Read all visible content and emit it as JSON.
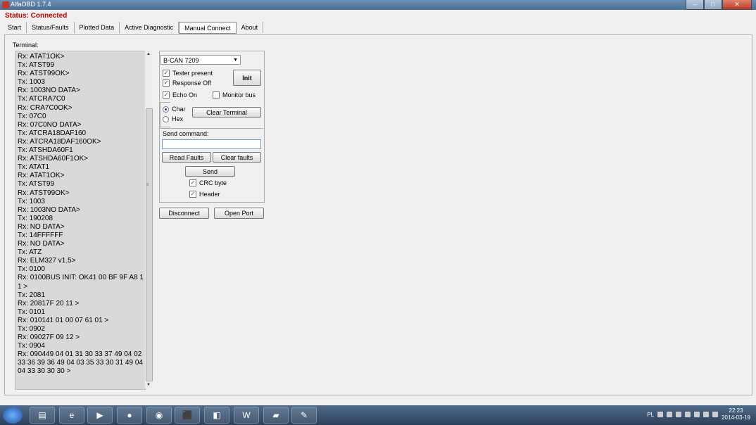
{
  "window": {
    "title": "AlfaOBD 1.7.4"
  },
  "status": "Status: Connected",
  "tabs": [
    "Start",
    "Status/Faults",
    "Plotted Data",
    "Active Diagnostic",
    "Manual Connect",
    "About"
  ],
  "active_tab": "Manual Connect",
  "terminal": {
    "label": "Terminal:",
    "lines": [
      "Rx: ATAT1OK>",
      "Tx: ATST99",
      "Rx: ATST99OK>",
      "Tx: 1003",
      "Rx: 1003NO DATA>",
      "Tx: ATCRA7C0",
      "Rx: CRA7C0OK>",
      "Tx: 07C0",
      "Rx: 07C0NO DATA>",
      "Tx: ATCRA18DAF160",
      "Rx: ATCRA18DAF160OK>",
      "Tx: ATSHDA60F1",
      "Rx: ATSHDA60F1OK>",
      "Tx: ATAT1",
      "Rx: ATAT1OK>",
      "Tx: ATST99",
      "Rx: ATST99OK>",
      "Tx: 1003",
      "Rx: 1003NO DATA>",
      "Tx: 190208",
      "Rx: NO DATA>",
      "Tx: 14FFFFFF",
      "Rx: NO DATA>",
      "Tx: ATZ",
      "Rx: ELM327 v1.5>",
      "Tx: 0100",
      "Rx: 0100BUS INIT: OK41 00 BF 9F A8 11 >",
      "Tx: 2081",
      "Rx: 20817F 20 11 >",
      "Tx: 0101",
      "Rx: 010141 01 00 07 61 01 >",
      "Tx: 0902",
      "Rx: 09027F 09 12 >",
      "Tx: 0904",
      "Rx: 090449 04 01 31 30 33 37 49 04 02 33 36 39 36 49 04 03 35 33 30 31 49 04 04 33 30 30 30 >"
    ]
  },
  "controls": {
    "bus_select": "B-CAN 7209",
    "tester_present": "Tester present",
    "response_off": "Response Off",
    "init": "Init",
    "echo_on": "Echo On",
    "monitor_bus": "Monitor bus",
    "char": "Char",
    "hex": "Hex",
    "clear_terminal": "Clear Terminal",
    "send_command_label": "Send command:",
    "send_command_value": "",
    "read_faults": "Read Faults",
    "clear_faults": "Clear faults",
    "send": "Send",
    "crc_byte": "CRC byte",
    "header": "Header",
    "disconnect": "Disconnect",
    "open_port": "Open Port",
    "check_mark": "✓"
  },
  "tray": {
    "lang": "PL",
    "time": "22:23",
    "date": "2014-03-19"
  }
}
